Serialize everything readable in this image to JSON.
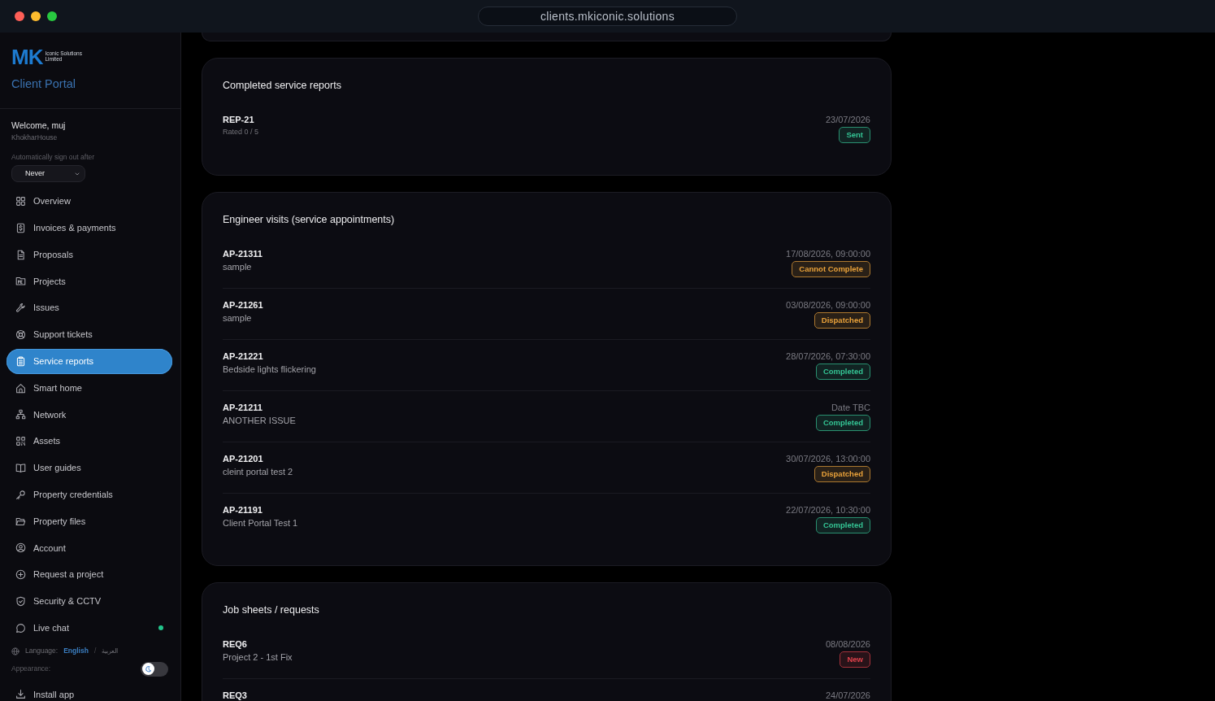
{
  "browser": {
    "address": "clients.mkiconic.solutions"
  },
  "sidebar": {
    "logo": {
      "mark": "MK",
      "company_lines": [
        "Iconic Solutions",
        "Limited"
      ]
    },
    "portal_title": "Client Portal",
    "welcome": "Welcome, muj",
    "property": "KhokharHouse",
    "auto_sign_out": {
      "label": "Automatically sign out after",
      "value": "Never"
    },
    "nav": [
      {
        "label": "Overview",
        "selected": false
      },
      {
        "label": "Invoices & payments",
        "selected": false
      },
      {
        "label": "Proposals",
        "selected": false
      },
      {
        "label": "Projects",
        "selected": false
      },
      {
        "label": "Issues",
        "selected": false
      },
      {
        "label": "Support tickets",
        "selected": false
      },
      {
        "label": "Service reports",
        "selected": true
      },
      {
        "label": "Smart home",
        "selected": false
      },
      {
        "label": "Network",
        "selected": false
      },
      {
        "label": "Assets",
        "selected": false
      },
      {
        "label": "User guides",
        "selected": false
      },
      {
        "label": "Property credentials",
        "selected": false
      },
      {
        "label": "Property files",
        "selected": false
      },
      {
        "label": "Account",
        "selected": false
      },
      {
        "label": "Request a project",
        "selected": false
      },
      {
        "label": "Security & CCTV",
        "selected": false
      },
      {
        "label": "Live chat",
        "selected": false,
        "online": true
      }
    ],
    "language": {
      "label": "Language:",
      "separator": "/",
      "options": [
        {
          "label": "English",
          "selected": true
        },
        {
          "label": "العربية",
          "selected": false
        }
      ]
    },
    "appearance": {
      "label": "Appearance:",
      "on": false
    },
    "install_app": "Install app"
  },
  "sections": [
    {
      "title": "Completed service reports",
      "rows": [
        {
          "id": "REP-21",
          "rating": "Rated 0 / 5",
          "date": "23/07/2026",
          "status": {
            "label": "Sent",
            "color": "#34c494"
          }
        }
      ]
    },
    {
      "title": "Engineer visits (service appointments)",
      "rows": [
        {
          "id": "AP-21311",
          "description": "sample",
          "date": "17/08/2026, 09:00:00",
          "status": {
            "label": "Cannot Complete",
            "color": "#eaa23a"
          }
        },
        {
          "id": "AP-21261",
          "description": "sample",
          "date": "03/08/2026, 09:00:00",
          "status": {
            "label": "Dispatched",
            "color": "#eaa23a"
          }
        },
        {
          "id": "AP-21221",
          "description": "Bedside lights flickering",
          "date": "28/07/2026, 07:30:00",
          "status": {
            "label": "Completed",
            "color": "#34c494"
          }
        },
        {
          "id": "AP-21211",
          "description": "ANOTHER ISSUE",
          "date": "Date TBC",
          "status": {
            "label": "Completed",
            "color": "#34c494"
          }
        },
        {
          "id": "AP-21201",
          "description": "cleint portal test 2",
          "date": "30/07/2026, 13:00:00",
          "status": {
            "label": "Dispatched",
            "color": "#eaa23a"
          }
        },
        {
          "id": "AP-21191",
          "description": "Client Portal Test 1",
          "date": "22/07/2026, 10:30:00",
          "status": {
            "label": "Completed",
            "color": "#34c494"
          }
        }
      ]
    },
    {
      "title": "Job sheets / requests",
      "rows": [
        {
          "id": "REQ6",
          "description": "Project 2 - 1st Fix",
          "date": "08/08/2026",
          "status": {
            "label": "New",
            "color": "#e0414b"
          }
        },
        {
          "id": "REQ3",
          "date": "24/07/2026"
        }
      ]
    }
  ]
}
